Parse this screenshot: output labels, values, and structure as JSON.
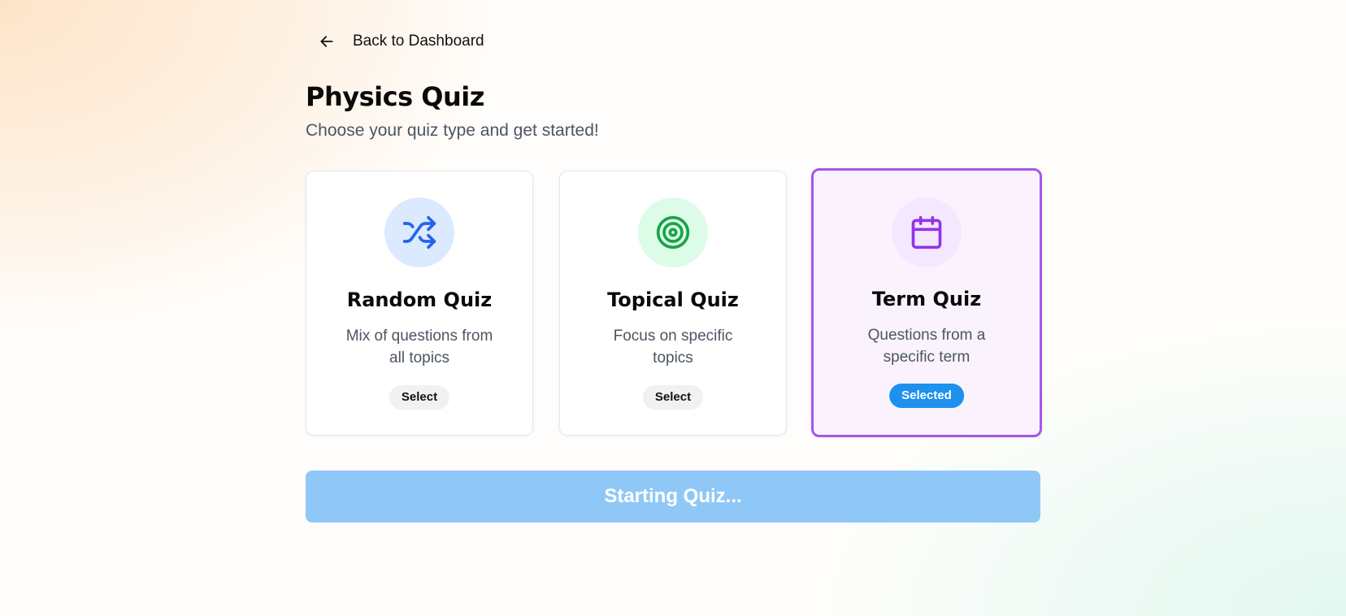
{
  "nav": {
    "back_label": "Back to Dashboard",
    "back_icon": "arrow-left-icon"
  },
  "header": {
    "title": "Physics Quiz",
    "subtitle": "Choose your quiz type and get started!"
  },
  "cards": [
    {
      "title": "Random Quiz",
      "desc_line1": "Mix of questions from",
      "desc_line2": "all topics",
      "badge": "Select",
      "icon": "shuffle-icon",
      "icon_color": "#2563eb",
      "icon_bg": "#dbeafe",
      "selected": false
    },
    {
      "title": "Topical Quiz",
      "desc_line1": "Focus on specific",
      "desc_line2": "topics",
      "badge": "Select",
      "icon": "target-icon",
      "icon_color": "#16a34a",
      "icon_bg": "#dcfce7",
      "selected": false
    },
    {
      "title": "Term Quiz",
      "desc_line1": "Questions from a",
      "desc_line2": "specific term",
      "badge": "Selected",
      "icon": "calendar-icon",
      "icon_color": "#9333ea",
      "icon_bg": "#f3e8ff",
      "selected": true
    }
  ],
  "start_button": {
    "label": "Starting Quiz...",
    "color": "#8fc8f6"
  },
  "colors": {
    "accent_purple": "#a855e7",
    "selected_badge": "#1e90ee"
  }
}
